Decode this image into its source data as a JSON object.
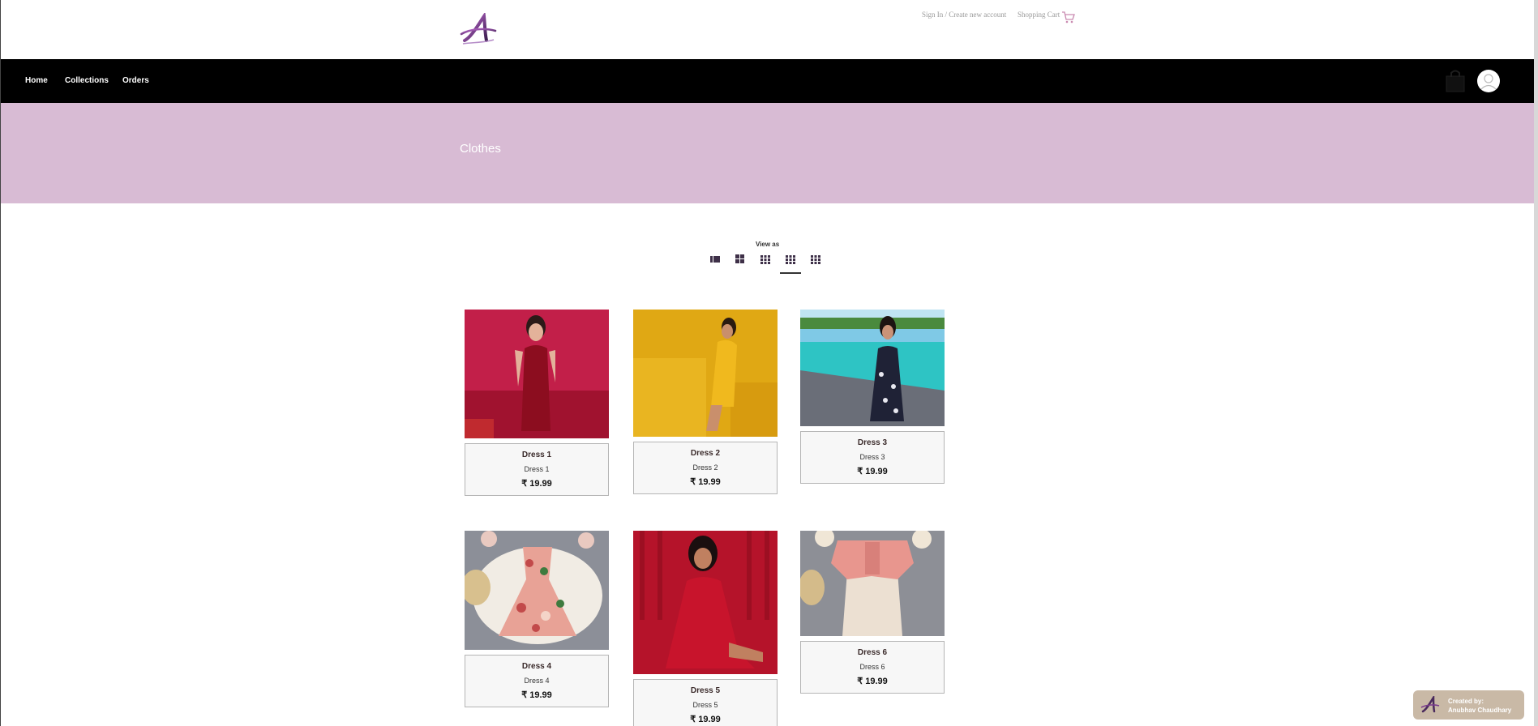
{
  "header": {
    "account_link": "Sign In / Create new account",
    "cart_link": "Shopping Cart"
  },
  "nav": {
    "items": [
      "Home",
      "Collections",
      "Orders"
    ]
  },
  "banner": {
    "title": "Clothes"
  },
  "view": {
    "label": "View as",
    "options": [
      "list-view",
      "grid-2",
      "grid-3",
      "grid-4",
      "grid-5"
    ],
    "active": "grid-4"
  },
  "products": [
    {
      "name": "Dress 1",
      "subtitle": "Dress 1",
      "price": "₹ 19.99"
    },
    {
      "name": "Dress 2",
      "subtitle": "Dress 2",
      "price": "₹ 19.99"
    },
    {
      "name": "Dress 3",
      "subtitle": "Dress 3",
      "price": "₹ 19.99"
    },
    {
      "name": "Dress 4",
      "subtitle": "Dress 4",
      "price": "₹ 19.99"
    },
    {
      "name": "Dress 5",
      "subtitle": "Dress 5",
      "price": "₹ 19.99"
    },
    {
      "name": "Dress 6",
      "subtitle": "Dress 6",
      "price": "₹ 19.99"
    }
  ],
  "credit": {
    "line1": "Created by:",
    "line2": "Anubhav Chaudhary"
  },
  "colors": {
    "banner": "#d8bbd4",
    "nav": "#000000",
    "accent": "#7a3c8c"
  }
}
